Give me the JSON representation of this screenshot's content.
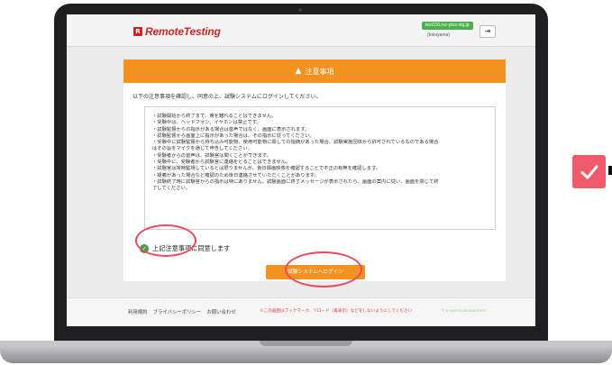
{
  "header": {
    "logo_mark": "R",
    "logo_text": "RemoteTesting",
    "account_badge": "test116.rsc-plus-stg.jp",
    "username": "(tokuyama)",
    "logout_icon": "logout-icon"
  },
  "panel": {
    "title": "注意事項",
    "title_icon": "warning-icon",
    "intro": "以下の注意事項を確認し、同意の上、試験システムにログインしてください。",
    "rules": [
      "・試験開始から終了まで、席を離れることはできません。",
      "・受験中は、ヘッドフォン、イヤホンは禁止です。",
      "・試験監督からの指示がある場合は音声ではなく、画面に表示されます。",
      "・試験監督から画面上に指示があった場合は、その指示に従ってください。",
      "・受験中に試験監督から持ち込み可能物、使用可能物に関しての指摘があった場合、試験実施団体から許可されているものである場合",
      "はその旨をマイクを通じて申告してください。",
      "・受験者からの音声は、試験官は聞くことができます。",
      "・受験中に、受験者から試験官に連絡をとることはできません。",
      "・試験官は常時監視しているとは限りませんが、後日録画映像を確認することで不正の有無を確認します。",
      "・疑義があった場合など確認のため後日連絡させていただくことがあります。",
      "・試験終了時に試験官からの指示は特にありません。試験画面に終了メッセージが表示されたら、画面の案内に従い、画面を閉じて終",
      "了してください。"
    ],
    "agree_label": "上記注意事項に同意します",
    "agree_checked": true,
    "login_button": "試験システムへログイン"
  },
  "footer": {
    "links": [
      "利用規約",
      "プライバシーポリシー",
      "お問い合わせ"
    ],
    "warning": "※この画面はブックマーク、リロード（再表示）などをしないようにしてください",
    "copyright": "© e-communications.inc."
  },
  "colors": {
    "accent_orange": "#f39221",
    "brand_red": "#c62828",
    "annotation_red": "#e84a5f",
    "check_green": "#43a047"
  }
}
